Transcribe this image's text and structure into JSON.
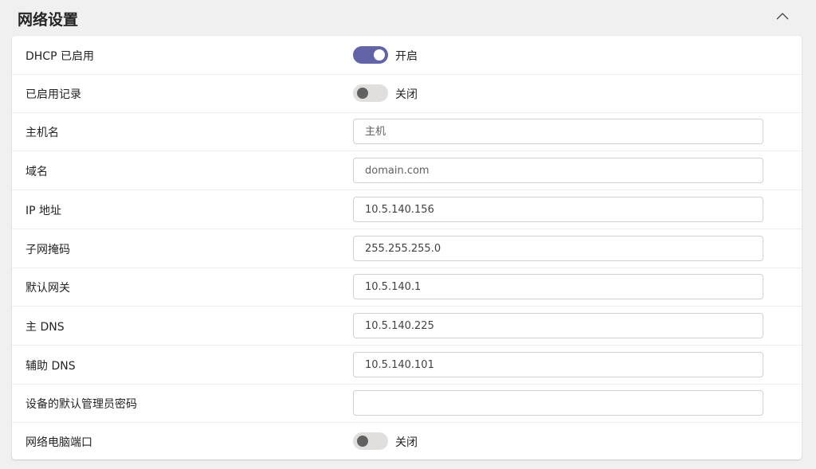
{
  "header": {
    "title": "网络设置"
  },
  "icons": {
    "collapse": "chevron-up-icon"
  },
  "colors": {
    "accent": "#6264a7",
    "toggle_off": "#e1dfdd"
  },
  "rows": [
    {
      "label": "DHCP 已启用",
      "toggle": {
        "on": true,
        "text": "开启"
      }
    },
    {
      "label": "已启用记录",
      "toggle": {
        "on": false,
        "text": "关闭"
      }
    },
    {
      "label": "主机名",
      "input": {
        "value": "",
        "placeholder": "主机"
      }
    },
    {
      "label": "域名",
      "input": {
        "value": "",
        "placeholder": "domain.com"
      }
    },
    {
      "label": "IP 地址",
      "input": {
        "value": "10.5.140.156",
        "placeholder": ""
      }
    },
    {
      "label": "子网掩码",
      "input": {
        "value": "255.255.255.0",
        "placeholder": ""
      }
    },
    {
      "label": "默认网关",
      "input": {
        "value": "10.5.140.1",
        "placeholder": ""
      }
    },
    {
      "label": "主 DNS",
      "input": {
        "value": "10.5.140.225",
        "placeholder": ""
      }
    },
    {
      "label": "辅助 DNS",
      "input": {
        "value": "10.5.140.101",
        "placeholder": ""
      }
    },
    {
      "label": "设备的默认管理员密码",
      "input": {
        "value": "",
        "placeholder": ""
      }
    },
    {
      "label": "网络电脑端口",
      "toggle": {
        "on": false,
        "text": "关闭"
      }
    }
  ]
}
